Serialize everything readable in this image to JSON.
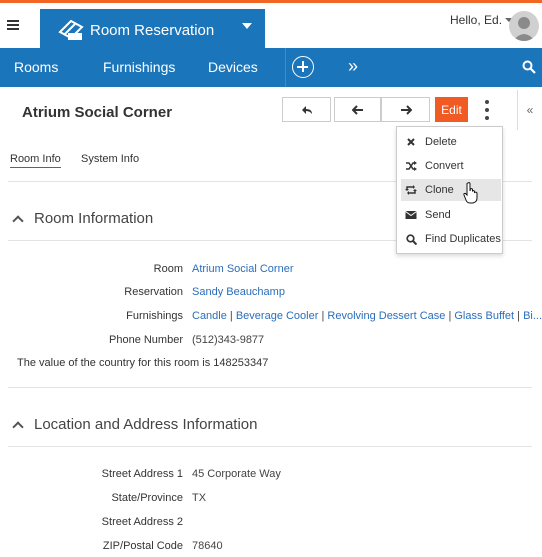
{
  "header": {
    "app_title": "Room Reservation",
    "greeting": "Hello, Ed.",
    "accent_color": "#f26522",
    "brand_color": "#1b75bb"
  },
  "nav": {
    "items": [
      "Rooms",
      "Furnishings",
      "Devices"
    ],
    "more_icon": "chevron-double-right-icon",
    "add_icon": "plus-circle-icon",
    "search_icon": "search-icon"
  },
  "record": {
    "title": "Atrium Social Corner",
    "edit_label": "Edit",
    "collapse_label": "«"
  },
  "tabs": [
    "Room Info",
    "System Info"
  ],
  "menu": {
    "items": [
      {
        "label": "Delete",
        "icon": "close-icon"
      },
      {
        "label": "Convert",
        "icon": "shuffle-icon"
      },
      {
        "label": "Clone",
        "icon": "retweet-icon"
      },
      {
        "label": "Send",
        "icon": "envelope-icon"
      },
      {
        "label": "Find Duplicates",
        "icon": "search-icon"
      }
    ],
    "hovered": "Clone"
  },
  "room_section": {
    "title": "Room Information",
    "fields": [
      {
        "label": "Room",
        "value": "Atrium Social Corner",
        "is_link": true
      },
      {
        "label": "Reservation",
        "value": "Sandy Beauchamp",
        "is_link": true
      },
      {
        "label": "Furnishings",
        "values": [
          "Candle",
          "Beverage Cooler",
          "Revolving Dessert Case",
          "Glass Buffet",
          "Bi..."
        ],
        "is_link": true
      },
      {
        "label": "Phone Number",
        "value": "(512)343-9877",
        "is_link": false
      }
    ],
    "note": "The value of the country for this room is 148253347"
  },
  "location_section": {
    "title": "Location and Address Information",
    "fields": [
      {
        "label": "Street Address 1",
        "value": "45 Corporate Way"
      },
      {
        "label": "State/Province",
        "value": "TX"
      },
      {
        "label": "Street Address 2",
        "value": ""
      },
      {
        "label": "ZIP/Postal Code",
        "value": "78640"
      }
    ]
  }
}
